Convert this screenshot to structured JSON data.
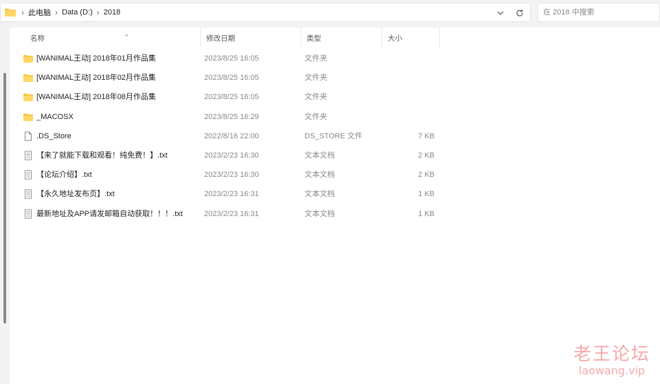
{
  "breadcrumb": {
    "items": [
      "此电脑",
      "Data (D:)",
      "2018"
    ]
  },
  "search": {
    "placeholder": "在 2018 中搜索"
  },
  "columns": {
    "name": "名称",
    "date": "修改日期",
    "type": "类型",
    "size": "大小"
  },
  "files": [
    {
      "name": "[WANIMAL王动] 2018年01月作品集",
      "date": "2023/8/25 16:05",
      "type": "文件夹",
      "size": "",
      "icon": "folder-icon"
    },
    {
      "name": "[WANIMAL王动] 2018年02月作品集",
      "date": "2023/8/25 16:05",
      "type": "文件夹",
      "size": "",
      "icon": "folder-icon"
    },
    {
      "name": "[WANIMAL王动] 2018年08月作品集",
      "date": "2023/8/25 16:05",
      "type": "文件夹",
      "size": "",
      "icon": "folder-icon"
    },
    {
      "name": "_MACOSX",
      "date": "2023/8/25 16:29",
      "type": "文件夹",
      "size": "",
      "icon": "folder-icon"
    },
    {
      "name": ".DS_Store",
      "date": "2022/8/16 22:00",
      "type": "DS_STORE 文件",
      "size": "7 KB",
      "icon": "file-icon"
    },
    {
      "name": "【来了就能下载和观看！纯免费！】.txt",
      "date": "2023/2/23 16:30",
      "type": "文本文档",
      "size": "2 KB",
      "icon": "text-file-icon"
    },
    {
      "name": "【论坛介绍】.txt",
      "date": "2023/2/23 16:30",
      "type": "文本文档",
      "size": "2 KB",
      "icon": "text-file-icon"
    },
    {
      "name": "【永久地址发布页】.txt",
      "date": "2023/2/23 16:31",
      "type": "文本文档",
      "size": "1 KB",
      "icon": "text-file-icon"
    },
    {
      "name": "最新地址及APP请发邮箱自动获取！！！.txt",
      "date": "2023/2/23 16:31",
      "type": "文本文档",
      "size": "1 KB",
      "icon": "text-file-icon"
    }
  ],
  "watermark": {
    "cn": "老王论坛",
    "en": "laowang.vip"
  },
  "colors": {
    "folder": "#f4c443",
    "background": "#f3f3f3",
    "pane": "#ffffff",
    "watermark": "#f5aaaa"
  }
}
